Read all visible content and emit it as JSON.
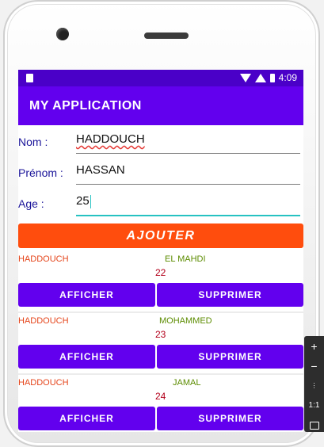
{
  "status_bar": {
    "time": "4:09"
  },
  "app_bar": {
    "title": "MY APPLICATION"
  },
  "form": {
    "nom_label": "Nom :",
    "nom_value": "HADDOUCH",
    "prenom_label": "Prénom :",
    "prenom_value": "HASSAN",
    "age_label": "Age :",
    "age_value": "25",
    "add_label": "AJOUTER"
  },
  "list": [
    {
      "nom": "HADDOUCH",
      "prenom": "EL MAHDI",
      "age": "22",
      "show_label": "AFFICHER",
      "delete_label": "SUPPRIMER"
    },
    {
      "nom": "HADDOUCH",
      "prenom": "MOHAMMED",
      "age": "23",
      "show_label": "AFFICHER",
      "delete_label": "SUPPRIMER"
    },
    {
      "nom": "HADDOUCH",
      "prenom": "JAMAL",
      "age": "24",
      "show_label": "AFFICHER",
      "delete_label": "SUPPRIMER"
    }
  ],
  "side_panel": {
    "zoom_in": "+",
    "zoom_out": "−",
    "one_to_one": "1:1"
  },
  "colors": {
    "primary": "#6200ee",
    "primary_dark": "#4a00c8",
    "accent_button": "#ff4d0d",
    "nom_text": "#e5441a",
    "prenom_text": "#5c8c00",
    "age_text": "#b3001b"
  }
}
